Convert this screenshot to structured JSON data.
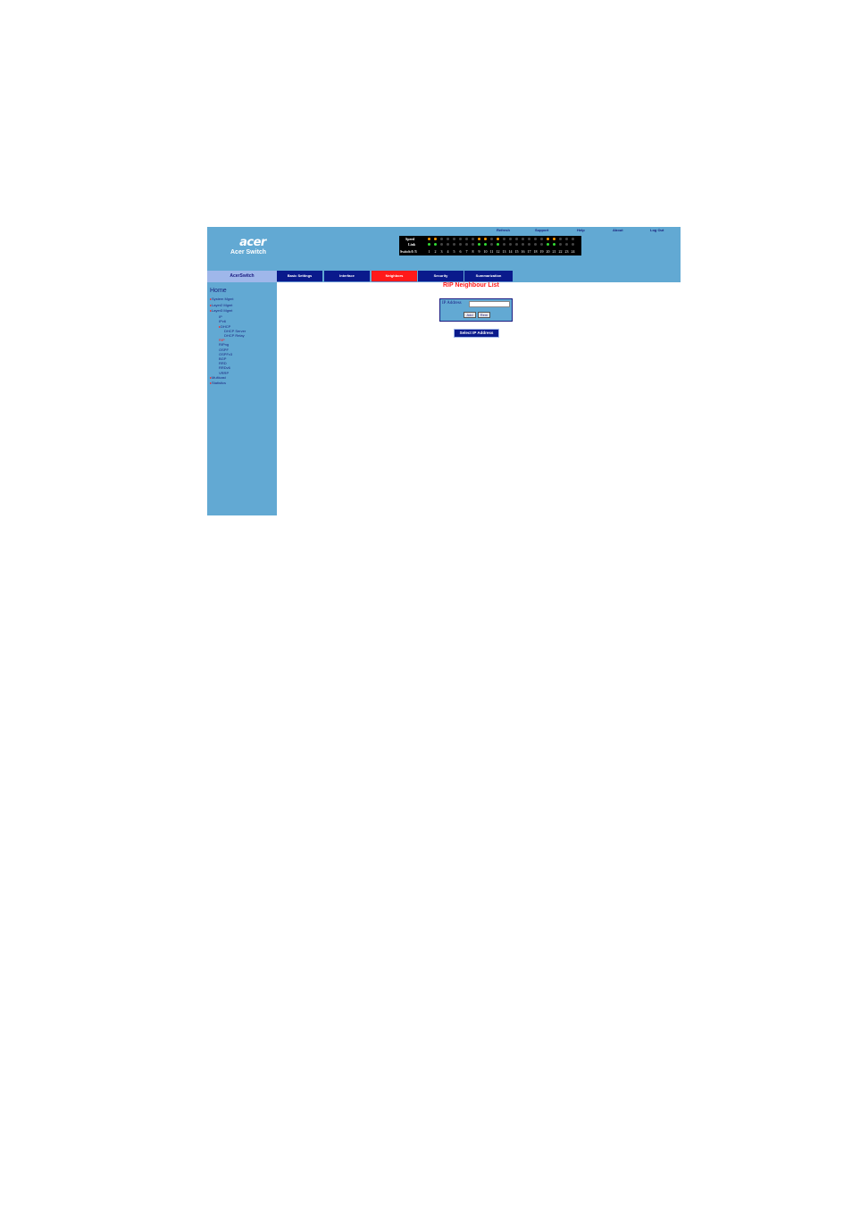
{
  "header": {
    "logo_text": "acer",
    "product_name": "Acer Switch",
    "links": [
      "Refresh",
      "Support",
      "Help",
      "About",
      "Log Out"
    ]
  },
  "port_panel": {
    "speed_label": "Speed",
    "link_label": "Link",
    "switch_label": "Switch 0 /3",
    "ports": [
      "1",
      "2",
      "3",
      "4",
      "5",
      "6",
      "7",
      "8",
      "9",
      "10",
      "11",
      "12",
      "13",
      "14",
      "15",
      "16",
      "17",
      "18",
      "19",
      "20",
      "21",
      "22",
      "23",
      "24"
    ],
    "colors": {
      "green": "#33dd33",
      "orange": "#ff9900",
      "off": "#444444"
    }
  },
  "sidebar": {
    "title": "AcerSwitch",
    "home": "Home",
    "items": [
      {
        "label": "System Mgmt",
        "level": 0,
        "arrow": true
      },
      {
        "label": "Layer2 Mgmt",
        "level": 0,
        "arrow": true
      },
      {
        "label": "Layer3 Mgmt",
        "level": 0,
        "arrow": true
      },
      {
        "label": "IP",
        "level": 1,
        "arrow": false
      },
      {
        "label": "IPv6",
        "level": 1,
        "arrow": false
      },
      {
        "label": "DHCP",
        "level": 1,
        "arrow": true
      },
      {
        "label": "DHCP Server",
        "level": 2,
        "arrow": false
      },
      {
        "label": "DHCP Relay",
        "level": 2,
        "arrow": false
      },
      {
        "label": "RIP",
        "level": 1,
        "arrow": false,
        "active": true
      },
      {
        "label": "RIPng",
        "level": 1,
        "arrow": false
      },
      {
        "label": "OSPF",
        "level": 1,
        "arrow": false
      },
      {
        "label": "OSPFv3",
        "level": 1,
        "arrow": false
      },
      {
        "label": "BGP",
        "level": 1,
        "arrow": false
      },
      {
        "label": "RRD",
        "level": 1,
        "arrow": false
      },
      {
        "label": "RRDv6",
        "level": 1,
        "arrow": false
      },
      {
        "label": "VRRP",
        "level": 1,
        "arrow": false
      },
      {
        "label": "Multicast",
        "level": 0,
        "arrow": true
      },
      {
        "label": "Statistics",
        "level": 0,
        "arrow": true
      }
    ]
  },
  "tabs": [
    {
      "label": "Basic Settings",
      "active": false
    },
    {
      "label": "Interface",
      "active": false
    },
    {
      "label": "Neighbors",
      "active": true
    },
    {
      "label": "Security",
      "active": false
    },
    {
      "label": "Summarization",
      "active": false
    }
  ],
  "main": {
    "title": "RIP Neighbour List",
    "ip_label": "IP Address",
    "ip_value": "",
    "add_label": "Add",
    "remove_label": "Rem",
    "select_label": "Select IP Address"
  }
}
